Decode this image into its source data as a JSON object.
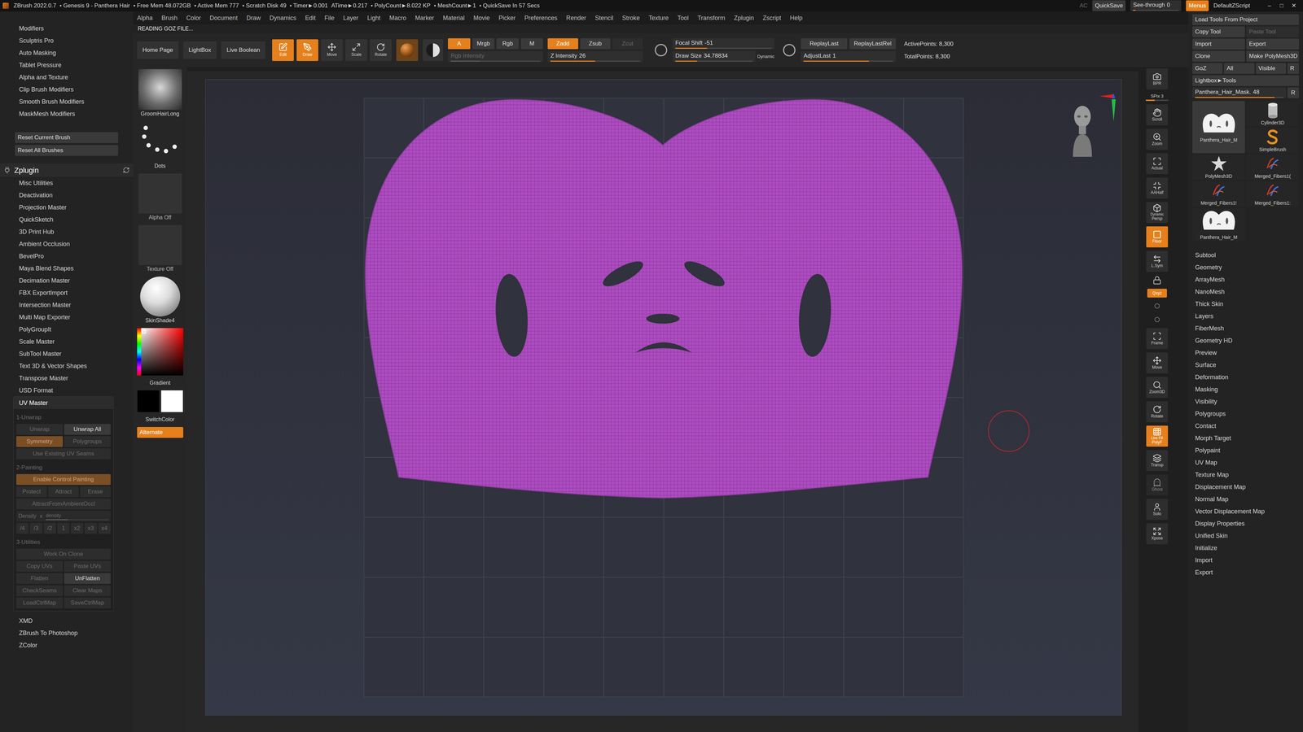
{
  "title_bar": {
    "segments": [
      "ZBrush 2022.0.7",
      "• Genesis 9 - Panthera Hair",
      "• Free Mem 48.072GB",
      "• Active Mem 777",
      "• Scratch Disk 49",
      "• Timer►0.001",
      "ATime►0.217",
      "• PolyCount►8.022 KP",
      "• MeshCount►1",
      "• QuickSave In 57 Secs"
    ],
    "right": [
      {
        "label": "AC",
        "kind": "text",
        "selected": false,
        "disabled": true
      },
      {
        "label": "QuickSave",
        "kind": "button",
        "selected": false,
        "disabled": false
      },
      {
        "label": "See-through",
        "value": "0",
        "kind": "slider",
        "level": 0.05,
        "selected": false,
        "disabled": false
      },
      {
        "label": "Menus",
        "kind": "button",
        "selected": true,
        "disabled": false
      },
      {
        "label": "DefaultZScript",
        "kind": "text",
        "selected": false,
        "disabled": false
      }
    ],
    "window_controls": [
      "–",
      "□",
      "✕"
    ]
  },
  "menu_bar": [
    "Alpha",
    "Brush",
    "Color",
    "Document",
    "Draw",
    "Dynamics",
    "Edit",
    "File",
    "Layer",
    "Light",
    "Macro",
    "Marker",
    "Material",
    "Movie",
    "Picker",
    "Preferences",
    "Render",
    "Stencil",
    "Stroke",
    "Texture",
    "Tool",
    "Transform",
    "Zplugin",
    "Zscript",
    "Help"
  ],
  "status": "READING GOZ FILE...",
  "toolbar": {
    "nav": [
      "Home Page",
      "LightBox",
      "Live Boolean"
    ],
    "modes": [
      {
        "label": "Edit",
        "selected": true
      },
      {
        "label": "Draw",
        "selected": true
      },
      {
        "label": "Move",
        "selected": false
      },
      {
        "label": "Scale",
        "selected": false
      },
      {
        "label": "Rotate",
        "selected": false
      }
    ],
    "material_selected": true,
    "rgb_channels": [
      {
        "label": "A",
        "selected": true,
        "disabled": false
      },
      {
        "label": "Mrgb",
        "selected": false,
        "disabled": false
      },
      {
        "label": "Rgb",
        "selected": false,
        "disabled": false
      },
      {
        "label": "M",
        "selected": false,
        "disabled": false
      }
    ],
    "rgb_intensity": {
      "label": "Rgb Intensity",
      "disabled": true,
      "level": 0.33
    },
    "z_channels": [
      {
        "label": "Zadd",
        "selected": true,
        "disabled": false
      },
      {
        "label": "Zsub",
        "selected": false,
        "disabled": false
      },
      {
        "label": "Zcut",
        "selected": false,
        "disabled": true
      }
    ],
    "z_intensity": {
      "label": "Z Intensity",
      "value": "26",
      "level": 0.5
    },
    "focal_shift": {
      "label": "Focal Shift",
      "value": "-51",
      "level": 0.33
    },
    "draw_size": {
      "label": "Draw Size",
      "value": "34.78834",
      "level": 0.28
    },
    "dynamic": "Dynamic",
    "replay": [
      "ReplayLast",
      "ReplayLastRel"
    ],
    "adjust_last": {
      "label": "AdjustLast",
      "value": "1",
      "level": 0.73
    },
    "stats": [
      "ActivePoints: 8,300",
      "TotalPoints: 8,300"
    ]
  },
  "left_panel": {
    "brush_modifiers": [
      "Modifiers",
      "Sculptris Pro",
      "Auto Masking",
      "Tablet Pressure",
      "Alpha and Texture",
      "Clip Brush Modifiers",
      "Smooth Brush Modifiers",
      "MaskMesh Modifiers"
    ],
    "reset_buttons": [
      "Reset Current Brush",
      "Reset All Brushes"
    ],
    "zplugin": {
      "title": "Zplugin",
      "items": [
        "Misc Utilities",
        "Deactivation",
        "Projection Master",
        "QuickSketch",
        "3D Print Hub",
        "Ambient Occlusion",
        "BevelPro",
        "Maya Blend Shapes",
        "Decimation Master",
        "FBX ExportImport",
        "Intersection Master",
        "Multi Map Exporter",
        "PolyGroupIt",
        "Scale Master",
        "SubTool Master",
        "Text 3D & Vector Shapes",
        "Transpose Master",
        "USD Format"
      ]
    },
    "uv_master": {
      "label": "UV Master",
      "expanded": true,
      "sections": [
        {
          "title": "1-Unwrap",
          "rows": [
            [
              {
                "kind": "button",
                "label": "Unwrap",
                "selected": false,
                "disabled": true
              },
              {
                "kind": "button",
                "label": "Unwrap All",
                "selected": false,
                "disabled": false
              }
            ],
            [
              {
                "kind": "button",
                "label": "Symmetry",
                "selected": true,
                "disabled": true
              },
              {
                "kind": "button",
                "label": "Polygroups",
                "selected": false,
                "disabled": true
              }
            ],
            [
              {
                "kind": "button",
                "label": "Use Existing UV Seams",
                "selected": false,
                "disabled": true
              }
            ]
          ]
        },
        {
          "title": "2-Painting",
          "rows": [
            [
              {
                "kind": "button",
                "label": "Enable Control Painting",
                "selected": true,
                "disabled": true
              }
            ],
            [
              {
                "kind": "button",
                "label": "Protect",
                "selected": false,
                "disabled": true
              },
              {
                "kind": "button",
                "label": "Attract",
                "selected": false,
                "disabled": true
              },
              {
                "kind": "button",
                "label": "Erase",
                "selected": false,
                "disabled": true
              }
            ],
            [
              {
                "kind": "button",
                "label": "AttractFromAmbientOccl",
                "selected": false,
                "disabled": true
              }
            ],
            [
              {
                "kind": "slider",
                "label": "Density",
                "value": "x",
                "field": "density",
                "level": 0.35,
                "selected": false,
                "disabled": true
              }
            ],
            [
              {
                "kind": "button",
                "label": "/4",
                "selected": false,
                "disabled": true
              },
              {
                "kind": "button",
                "label": "/3",
                "selected": false,
                "disabled": true
              },
              {
                "kind": "button",
                "label": "/2",
                "selected": false,
                "disabled": true
              },
              {
                "kind": "button",
                "label": "1",
                "selected": false,
                "disabled": true
              },
              {
                "kind": "button",
                "label": "x2",
                "selected": false,
                "disabled": true
              },
              {
                "kind": "button",
                "label": "x3",
                "selected": false,
                "disabled": true
              },
              {
                "kind": "button",
                "label": "x4",
                "selected": false,
                "disabled": true
              }
            ]
          ]
        },
        {
          "title": "3-Utilities",
          "rows": [
            [
              {
                "kind": "button",
                "label": "Work On Clone",
                "selected": false,
                "disabled": true
              }
            ],
            [
              {
                "kind": "button",
                "label": "Copy UVs",
                "selected": false,
                "disabled": true
              },
              {
                "kind": "button",
                "label": "Paste UVs",
                "selected": false,
                "disabled": true
              }
            ],
            [
              {
                "kind": "button",
                "label": "Flatten",
                "selected": false,
                "disabled": true
              },
              {
                "kind": "button",
                "label": "UnFlatten",
                "selected": false,
                "disabled": false
              }
            ],
            [
              {
                "kind": "button",
                "label": "CheckSeams",
                "selected": false,
                "disabled": true
              },
              {
                "kind": "button",
                "label": "Clear Maps",
                "selected": false,
                "disabled": true
              }
            ],
            [
              {
                "kind": "button",
                "label": "LoadCtrlMap",
                "selected": false,
                "disabled": true
              },
              {
                "kind": "button",
                "label": "SaveCtrlMap",
                "selected": false,
                "disabled": true
              }
            ]
          ]
        }
      ]
    },
    "zplugin_tail": [
      "XMD",
      "ZBrush To Photoshop",
      "ZColor"
    ]
  },
  "shelf": {
    "brush": "GroomHairLong",
    "stroke": "Dots",
    "alpha": "Alpha Off",
    "texture": "Texture Off",
    "material": "SkinShade4",
    "gradient": "Gradient",
    "switch_color": "SwitchColor",
    "alternate": {
      "label": "Alternate",
      "selected": true
    }
  },
  "right_shelf": [
    {
      "kind": "icon",
      "label": "BPR",
      "selected": false
    },
    {
      "kind": "slider",
      "label": "SPix 3",
      "selected": false,
      "level": 0.4
    },
    {
      "kind": "icon",
      "label": "Scroll",
      "selected": false
    },
    {
      "kind": "icon",
      "label": "Zoom",
      "selected": false
    },
    {
      "kind": "icon",
      "label": "Actual",
      "selected": false
    },
    {
      "kind": "icon",
      "label": "AAHalf",
      "selected": false
    },
    {
      "kind": "icon",
      "label": "Persp",
      "caption": "Dynamic",
      "selected": false
    },
    {
      "kind": "icon",
      "label": "Floor",
      "selected": true
    },
    {
      "kind": "icon",
      "label": "L.Sym",
      "selected": false
    },
    {
      "kind": "lock",
      "selected": false
    },
    {
      "kind": "small",
      "label": "Qxyz",
      "selected": true
    },
    {
      "kind": "dot",
      "selected": false
    },
    {
      "kind": "dot",
      "selected": false
    },
    {
      "kind": "icon",
      "label": "Frame",
      "selected": false
    },
    {
      "kind": "icon",
      "label": "Move",
      "selected": false
    },
    {
      "kind": "icon",
      "label": "Zoom3D",
      "selected": false
    },
    {
      "kind": "icon",
      "label": "Rotate",
      "selected": false
    },
    {
      "kind": "icon",
      "label": "PolyF",
      "caption": "Line Fill",
      "selected": true
    },
    {
      "kind": "icon",
      "label": "Transp",
      "selected": false
    },
    {
      "kind": "icon",
      "label": "Ghost",
      "selected": false,
      "disabled": true
    },
    {
      "kind": "icon",
      "label": "Solo",
      "selected": false
    },
    {
      "kind": "icon",
      "label": "Xpose",
      "selected": false
    }
  ],
  "right_panel": {
    "load": "Load Tools From Project",
    "button_rows": [
      [
        {
          "label": "Copy Tool",
          "disabled": false
        },
        {
          "label": "Paste Tool",
          "disabled": true
        }
      ],
      [
        {
          "label": "Import",
          "disabled": false
        },
        {
          "label": "Export",
          "disabled": false
        }
      ],
      [
        {
          "label": "Clone",
          "disabled": false
        },
        {
          "label": "Make PolyMesh3D",
          "disabled": false
        }
      ],
      [
        {
          "label": "GoZ",
          "disabled": false
        },
        {
          "label": "All",
          "disabled": false
        },
        {
          "label": "Visible",
          "disabled": false
        },
        {
          "label": "R",
          "disabled": false
        }
      ]
    ],
    "lightbox": "Lightbox►Tools",
    "tool_slider": {
      "label": "Panthera_Hair_Mask.",
      "value": "48",
      "level": 0.9,
      "reset": "R"
    },
    "tools": [
      {
        "label": "Panthera_Hair_M",
        "kind": "hair",
        "selected": true
      },
      {
        "label": "Cylinder3D",
        "kind": "cylinder",
        "selected": false
      },
      {
        "label": "SimpleBrush",
        "kind": "simplebrush",
        "selected": false
      },
      {
        "label": "PolyMesh3D",
        "kind": "star",
        "selected": false
      },
      {
        "label": "Merged_Fibers1(",
        "kind": "fibers",
        "selected": false
      },
      {
        "label": "Merged_Fibers1!",
        "kind": "fibers",
        "selected": false
      },
      {
        "label": "Merged_Fibers1:",
        "kind": "fibers",
        "selected": false
      },
      {
        "label": "Panthera_Hair_M",
        "kind": "hair",
        "selected": false
      }
    ],
    "palettes": [
      "Subtool",
      "Geometry",
      "ArrayMesh",
      "NanoMesh",
      "Thick Skin",
      "Layers",
      "FiberMesh",
      "Geometry HD",
      "Preview",
      "Surface",
      "Deformation",
      "Masking",
      "Visibility",
      "Polygroups",
      "Contact",
      "Morph Target",
      "Polypaint",
      "UV Map",
      "Texture Map",
      "Displacement Map",
      "Normal Map",
      "Vector Displacement Map",
      "Display Properties",
      "Unified Skin",
      "Initialize",
      "Import",
      "Export"
    ]
  }
}
